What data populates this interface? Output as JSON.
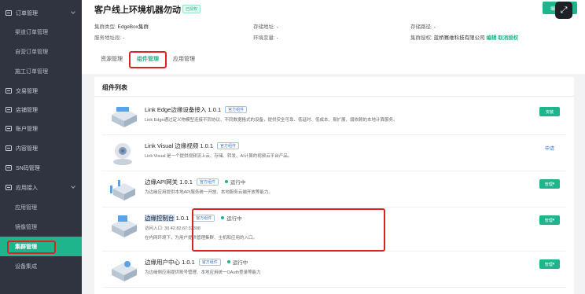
{
  "sidebar": {
    "items": [
      {
        "label": "订单管理",
        "type": "top",
        "chevron": true
      },
      {
        "label": "渠道订单管理",
        "type": "sub"
      },
      {
        "label": "自营订单管理",
        "type": "sub"
      },
      {
        "label": "施工订单管理",
        "type": "sub"
      },
      {
        "label": "交易管理",
        "type": "top"
      },
      {
        "label": "店铺管理",
        "type": "top"
      },
      {
        "label": "账户管理",
        "type": "top"
      },
      {
        "label": "内容管理",
        "type": "top"
      },
      {
        "label": "SN码管理",
        "type": "top"
      },
      {
        "label": "应用接入",
        "type": "top",
        "chevron": true
      },
      {
        "label": "应用管理",
        "type": "sub"
      },
      {
        "label": "镜像管理",
        "type": "sub"
      },
      {
        "label": "集群管理",
        "type": "sub",
        "active": true
      },
      {
        "label": "设备集成",
        "type": "sub"
      }
    ]
  },
  "header": {
    "title": "客户线上环境机器勿动",
    "status_badge": "已授权",
    "cluster_type_label": "集群类型:",
    "cluster_type_value": "EdgeBox集群",
    "storage_addr_label": "存储地址:",
    "storage_addr_value": "-",
    "storage_path_label": "存储路径:",
    "storage_path_value": "-",
    "service_addr_label": "服务地址段:",
    "service_addr_value": "-",
    "env_var_label": "环境变量:",
    "env_var_value": "-",
    "cluster_auth_label": "集群授权:",
    "cluster_auth_value": "蓝桥赛维科技有限公司",
    "edit_label": "编辑",
    "cancel_auth_label": "取消授权",
    "top_button_label": "编"
  },
  "tabs": [
    {
      "label": "资源管理"
    },
    {
      "label": "组件管理",
      "active": true
    },
    {
      "label": "应用管理"
    }
  ],
  "panel": {
    "title": "组件列表",
    "components": [
      {
        "name": "Link Edge边缘设备接入",
        "version": "1.0.1",
        "tag": "官方组件",
        "status": "",
        "desc": "Link Edge通过定义物模型连接不同协议、不同数据格式的设备，提供安全可靠、低延时、低成本、易扩展、弱依赖的本地计算服务。",
        "desc2": "",
        "action": "安装",
        "action_style": "button"
      },
      {
        "name": "Link Visual 边缘视频",
        "version": "1.0.1",
        "tag": "官方组件",
        "status": "",
        "desc": "Link Visual 是一个提供视频流上云、存储、转发、AI计算的视频云平台产品。",
        "desc2": "",
        "action": "申请",
        "action_style": "text"
      },
      {
        "name": "边缘API网关",
        "version": "1.0.1",
        "tag": "官方组件",
        "status": "运行中",
        "desc": "为边缘应用提供本地API服务统一开放、本地服务云端开放等能力。",
        "desc2": "",
        "action": "管理",
        "action_style": "button"
      },
      {
        "name": "边缘控制台",
        "version": "1.0.1",
        "tag": "官方组件",
        "status": "运行中",
        "desc": "访问入口: 30.42.82.67:32308",
        "desc2": "在内网环境下，为用户提供管理集群、主机和应用的入口。",
        "action": "管理",
        "action_style": "button"
      },
      {
        "name": "边缘用户中心",
        "version": "1.0.1",
        "tag": "官方组件",
        "status": "运行中",
        "desc": "为边缘侧应用提供账号管理、本地应用统一OAuth登录等能力",
        "desc2": "",
        "action": "管理",
        "action_style": "button"
      }
    ]
  },
  "colors": {
    "accent": "#1fb58c",
    "sidebar_bg": "#2f3440",
    "highlight_red": "#dd2222",
    "tag_blue": "#3a7bd5"
  },
  "icons": {
    "expand": "expand-arrows-icon"
  }
}
